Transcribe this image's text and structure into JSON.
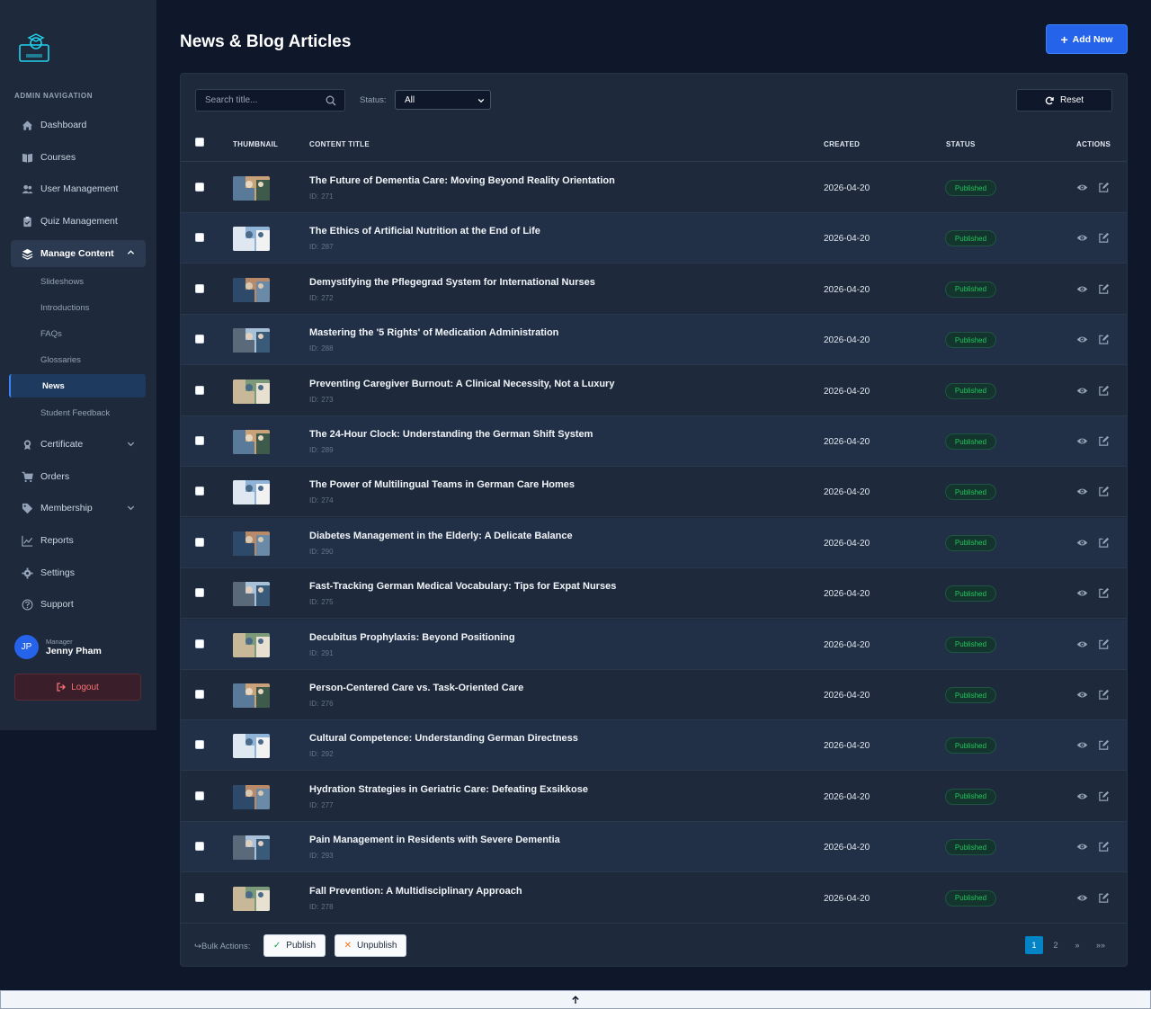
{
  "sidebar": {
    "nav_heading": "ADMIN NAVIGATION",
    "items": [
      {
        "label": "Dashboard",
        "icon": "home-icon"
      },
      {
        "label": "Courses",
        "icon": "book-icon"
      },
      {
        "label": "User Management",
        "icon": "users-icon"
      },
      {
        "label": "Quiz Management",
        "icon": "clipboard-icon"
      },
      {
        "label": "Manage Content",
        "icon": "layers-icon"
      },
      {
        "label": "Certificate",
        "icon": "award-icon"
      },
      {
        "label": "Orders",
        "icon": "cart-icon"
      },
      {
        "label": "Membership",
        "icon": "tag-icon"
      },
      {
        "label": "Reports",
        "icon": "chart-line-icon"
      },
      {
        "label": "Settings",
        "icon": "gear-icon"
      },
      {
        "label": "Support",
        "icon": "help-circle-icon"
      }
    ],
    "sub_items": [
      "Slideshows",
      "Introductions",
      "FAQs",
      "Glossaries",
      "News",
      "Student Feedback"
    ],
    "active_sub": "News",
    "user": {
      "initials": "JP",
      "role": "Manager",
      "name": "Jenny Pham"
    },
    "logout_label": "Logout"
  },
  "header": {
    "title": "News & Blog Articles",
    "add_label": "Add New"
  },
  "filters": {
    "search_placeholder": "Search title...",
    "status_label": "Status:",
    "status_value": "All",
    "reset_label": "Reset"
  },
  "table": {
    "columns": [
      "THUMBNAIL",
      "CONTENT TITLE",
      "CREATED",
      "STATUS",
      "ACTIONS"
    ],
    "id_prefix": "ID:",
    "rows": [
      {
        "title": "The Future of Dementia Care: Moving Beyond Reality Orientation",
        "id": "271",
        "created": "2026-04-20",
        "status": "Published"
      },
      {
        "title": "The Ethics of Artificial Nutrition at the End of Life",
        "id": "287",
        "created": "2026-04-20",
        "status": "Published"
      },
      {
        "title": "Demystifying the Pflegegrad System for International Nurses",
        "id": "272",
        "created": "2026-04-20",
        "status": "Published"
      },
      {
        "title": "Mastering the '5 Rights' of Medication Administration",
        "id": "288",
        "created": "2026-04-20",
        "status": "Published"
      },
      {
        "title": "Preventing Caregiver Burnout: A Clinical Necessity, Not a Luxury",
        "id": "273",
        "created": "2026-04-20",
        "status": "Published"
      },
      {
        "title": "The 24-Hour Clock: Understanding the German Shift System",
        "id": "289",
        "created": "2026-04-20",
        "status": "Published"
      },
      {
        "title": "The Power of Multilingual Teams in German Care Homes",
        "id": "274",
        "created": "2026-04-20",
        "status": "Published"
      },
      {
        "title": "Diabetes Management in the Elderly: A Delicate Balance",
        "id": "290",
        "created": "2026-04-20",
        "status": "Published"
      },
      {
        "title": "Fast-Tracking German Medical Vocabulary: Tips for Expat Nurses",
        "id": "275",
        "created": "2026-04-20",
        "status": "Published"
      },
      {
        "title": "Decubitus Prophylaxis: Beyond Positioning",
        "id": "291",
        "created": "2026-04-20",
        "status": "Published"
      },
      {
        "title": "Person-Centered Care vs. Task-Oriented Care",
        "id": "276",
        "created": "2026-04-20",
        "status": "Published"
      },
      {
        "title": "Cultural Competence: Understanding German Directness",
        "id": "292",
        "created": "2026-04-20",
        "status": "Published"
      },
      {
        "title": "Hydration Strategies in Geriatric Care: Defeating Exsikkose",
        "id": "277",
        "created": "2026-04-20",
        "status": "Published"
      },
      {
        "title": "Pain Management in Residents with Severe Dementia",
        "id": "293",
        "created": "2026-04-20",
        "status": "Published"
      },
      {
        "title": "Fall Prevention: A Multidisciplinary Approach",
        "id": "278",
        "created": "2026-04-20",
        "status": "Published"
      }
    ]
  },
  "bulk": {
    "label": "Bulk Actions:",
    "publish_label": "Publish",
    "unpublish_label": "Unpublish"
  },
  "pagination": {
    "pages": [
      "1",
      "2"
    ],
    "current": "1",
    "next": "»",
    "last": "»»"
  },
  "colors": {
    "accent": "#2563eb",
    "published_text": "#22c55e",
    "logout": "#f87171",
    "background": "#0f172a",
    "panel": "#1e293b"
  }
}
